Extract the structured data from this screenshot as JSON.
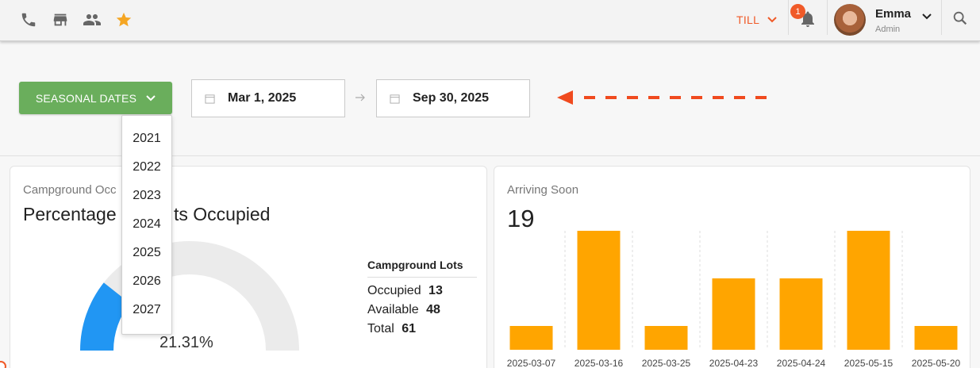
{
  "header": {
    "till_label": "TILL",
    "notification_count": "1",
    "user_name": "Emma",
    "user_role": "Admin",
    "icons": [
      "phone-icon",
      "store-icon",
      "people-icon",
      "star-icon",
      "bell-icon",
      "search-icon"
    ],
    "accent_color": "#f05a28",
    "star_color": "#f5a623"
  },
  "filters": {
    "seasonal_label": "SEASONAL DATES",
    "start_date": "Mar 1, 2025",
    "end_date": "Sep 30, 2025",
    "button_color": "#6aae5c"
  },
  "year_dropdown": {
    "options": [
      "2021",
      "2022",
      "2023",
      "2024",
      "2025",
      "2026",
      "2027"
    ]
  },
  "occupancy_card": {
    "subtitle": "Campground Occ",
    "title_left": "Percentage",
    "title_right": "ts Occupied",
    "percent_label": "21.31%",
    "occupied_fraction": 0.2131,
    "lots_title": "Campground Lots",
    "occupied_label": "Occupied",
    "occupied_value": "13",
    "available_label": "Available",
    "available_value": "48",
    "total_label": "Total",
    "total_value": "61",
    "gauge_fill_color": "#2196f3",
    "gauge_track_color": "#ebebeb"
  },
  "arriving_card": {
    "subtitle": "Arriving Soon",
    "count": "19",
    "bar_color": "#ffa500"
  },
  "chart_data": {
    "type": "bar",
    "categories": [
      "2025-03-07",
      "2025-03-16",
      "2025-03-25",
      "2025-04-23",
      "2025-04-24",
      "2025-05-15",
      "2025-05-20"
    ],
    "values": [
      1,
      5,
      1,
      3,
      3,
      5,
      1
    ],
    "ylim": [
      0,
      5
    ],
    "grid": "vertical-dashed"
  }
}
